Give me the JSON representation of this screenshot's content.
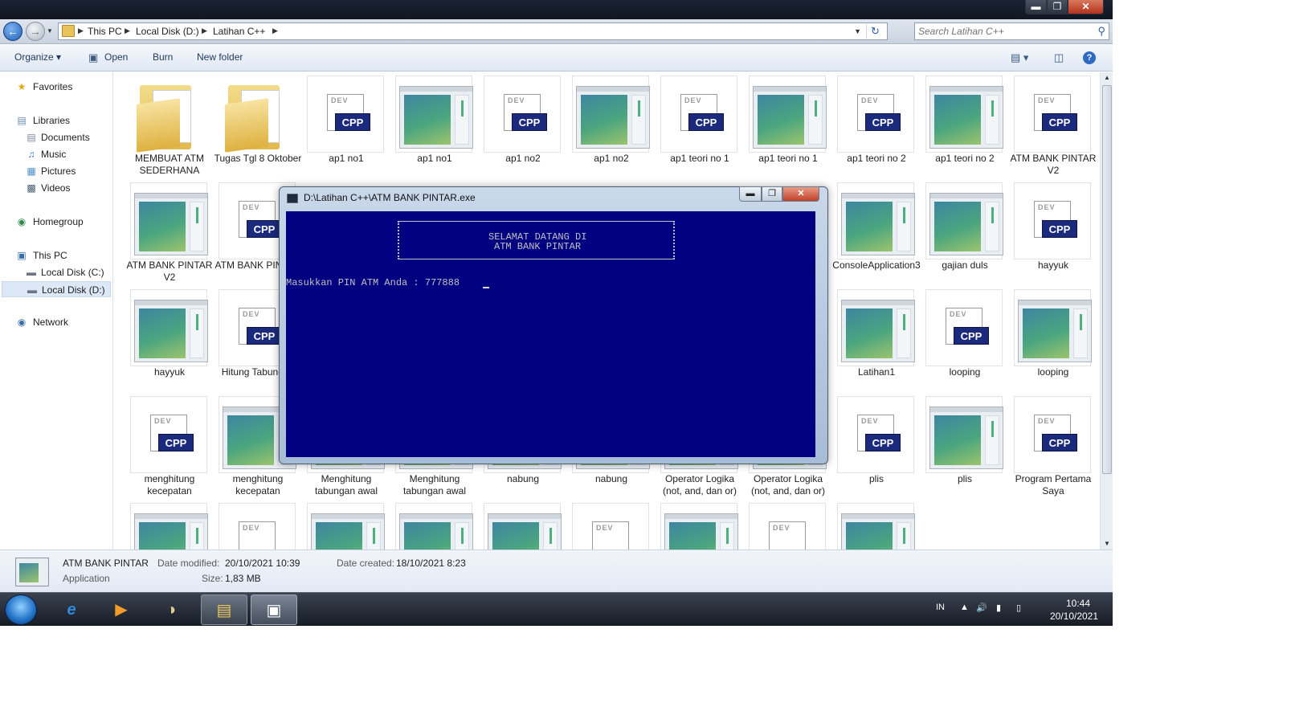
{
  "window": {
    "minimize": "▬",
    "maximize": "❐",
    "close": "✕"
  },
  "address": {
    "crumbs": [
      "This PC",
      "Local Disk (D:)",
      "Latihan C++"
    ],
    "search_placeholder": "Search Latihan C++"
  },
  "toolbar": {
    "organize": "Organize ▾",
    "open": "Open",
    "burn": "Burn",
    "new_folder": "New folder"
  },
  "nav": {
    "favorites": "Favorites",
    "libraries": "Libraries",
    "documents": "Documents",
    "music": "Music",
    "pictures": "Pictures",
    "videos": "Videos",
    "homegroup": "Homegroup",
    "this_pc": "This PC",
    "local_c": "Local Disk (C:)",
    "local_d": "Local Disk (D:)",
    "network": "Network"
  },
  "files": [
    {
      "name": "MEMBUAT ATM SEDERHANA",
      "type": "folder"
    },
    {
      "name": "Tugas Tgl 8 Oktober",
      "type": "folder"
    },
    {
      "name": "ap1 no1",
      "type": "cpp"
    },
    {
      "name": "ap1 no1",
      "type": "app"
    },
    {
      "name": "ap1 no2",
      "type": "cpp"
    },
    {
      "name": "ap1 no2",
      "type": "app"
    },
    {
      "name": "ap1 teori no 1",
      "type": "cpp"
    },
    {
      "name": "ap1 teori no 1",
      "type": "app"
    },
    {
      "name": "ap1 teori no 2",
      "type": "cpp"
    },
    {
      "name": "ap1 teori no 2",
      "type": "app"
    },
    {
      "name": "ATM BANK PINTAR V2",
      "type": "cpp"
    },
    {
      "name": "ATM BANK PINTAR V2",
      "type": "app"
    },
    {
      "name": "ATM BANK PINTAR",
      "type": "cpp"
    },
    {
      "name": "ConsoleApplication3",
      "type": "app"
    },
    {
      "name": "gajian duls",
      "type": "app"
    },
    {
      "name": "hayyuk",
      "type": "cpp"
    },
    {
      "name": "hayyuk",
      "type": "app"
    },
    {
      "name": "Hitung Tabungan",
      "type": "cpp"
    },
    {
      "name": "Latihan1",
      "type": "app"
    },
    {
      "name": "looping",
      "type": "cpp"
    },
    {
      "name": "looping",
      "type": "app"
    },
    {
      "name": "menghitung kecepatan",
      "type": "cpp"
    },
    {
      "name": "menghitung kecepatan",
      "type": "app"
    },
    {
      "name": "Menghitung tabungan awal",
      "type": "app"
    },
    {
      "name": "Menghitung tabungan awal",
      "type": "app"
    },
    {
      "name": "nabung",
      "type": "app"
    },
    {
      "name": "nabung",
      "type": "app"
    },
    {
      "name": "Operator Logika (not, and, dan or)",
      "type": "app"
    },
    {
      "name": "Operator Logika (not, and, dan or)",
      "type": "app"
    },
    {
      "name": "plis",
      "type": "cpp"
    },
    {
      "name": "plis",
      "type": "app"
    },
    {
      "name": "Program Pertama Saya",
      "type": "cpp"
    }
  ],
  "cpp_badge": "CPP",
  "dev_label": "DEV",
  "details": {
    "name": "ATM BANK PINTAR",
    "type": "Application",
    "modified_label": "Date modified:",
    "modified_value": "20/10/2021 10:39",
    "created_label": "Date created:",
    "created_value": "18/10/2021 8:23",
    "size_label": "Size:",
    "size_value": "1,83 MB"
  },
  "console": {
    "title": "D:\\Latihan C++\\ATM BANK PINTAR.exe",
    "banner_line1": "SELAMAT DATANG DI",
    "banner_line2": "ATM BANK PINTAR",
    "prompt": "Masukkan PIN ATM Anda : 777888"
  },
  "taskbar": {
    "lang": "IN",
    "time": "10:44",
    "date": "20/10/2021"
  },
  "colors": {
    "console_bg": "#000080",
    "console_text": "#c0c0c0",
    "cpp_badge": "#1b2a7c"
  }
}
